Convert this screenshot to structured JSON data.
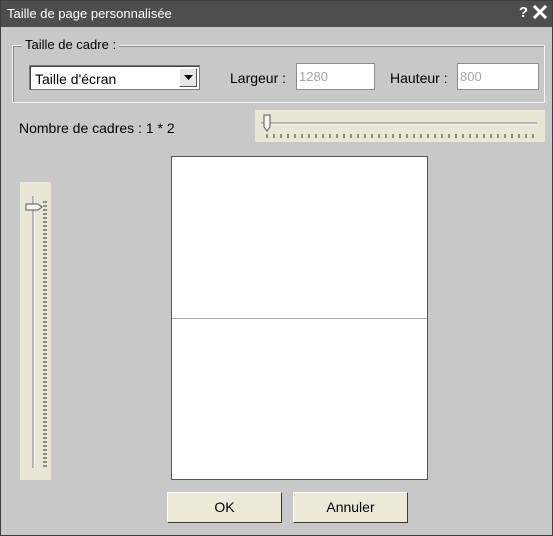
{
  "window": {
    "title": "Taille de page personnalisée",
    "help_glyph": "?"
  },
  "frame_size": {
    "legend": "Taille de cadre :",
    "preset_value": "Taille d'écran",
    "width_label": "Largeur :",
    "width_value": "1280",
    "height_label": "Hauteur :",
    "height_value": "800"
  },
  "frame_count": {
    "label": "Nombre de cadres : 1 * 2",
    "columns": 1,
    "rows": 2
  },
  "buttons": {
    "ok": "OK",
    "cancel": "Annuler"
  },
  "icons": {
    "help": "help-icon",
    "close": "close-icon",
    "dropdown": "chevron-down-icon"
  },
  "colors": {
    "titlebar": "#4e4e4e",
    "dialog_bg": "#c8c8c8",
    "slider_track_bg": "#eae6d6"
  }
}
